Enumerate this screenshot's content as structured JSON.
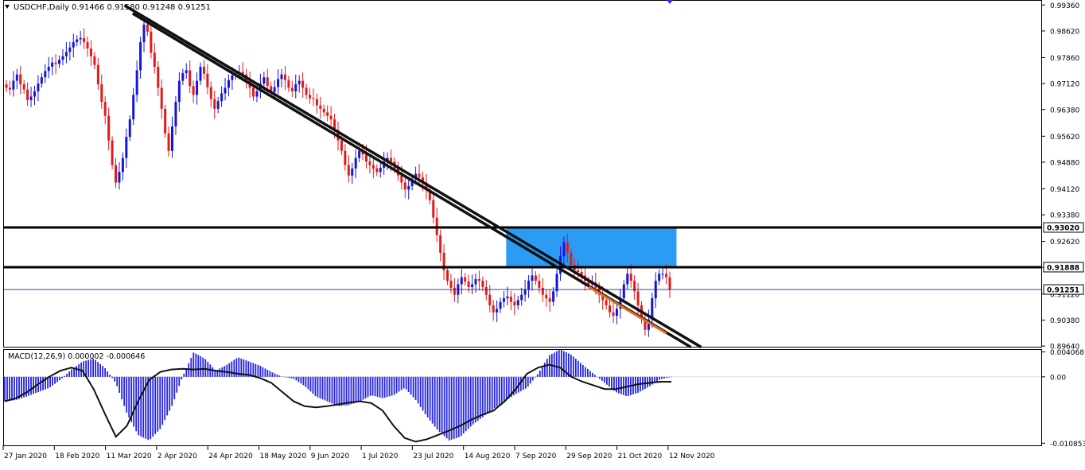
{
  "header": {
    "symbol_label": "USDCHF,Daily",
    "ohlc": "0.91466 0.91580 0.91248 0.91251"
  },
  "macd_header": "MACD(12,26,9) 0.000002 -0.000646",
  "colors": {
    "bull": "#1515d8",
    "bear": "#e01b1b",
    "zone": "#2196f3",
    "trend_line": "#111111",
    "level_line": "#000000",
    "current_line": "#2020a0",
    "orange_segment": "#e06b1e",
    "macd_hist": "#2323e0",
    "macd_signal": "#111111"
  },
  "chart_data": [
    {
      "type": "candlestick",
      "title": "USDCHF,Daily",
      "y_ticks": [
        "0.99360",
        "0.98620",
        "0.97860",
        "0.97120",
        "0.96380",
        "0.95620",
        "0.94880",
        "0.94120",
        "0.93380",
        "0.92620",
        "0.91880",
        "0.91120",
        "0.90380",
        "0.89640"
      ],
      "ylim": [
        0.8962,
        0.9948
      ],
      "x_ticks": [
        "27 Jan 2020",
        "18 Feb 2020",
        "11 Mar 2020",
        "2 Apr 2020",
        "24 Apr 2020",
        "18 May 2020",
        "9 Jun 2020",
        "1 Jul 2020",
        "23 Jul 2020",
        "14 Aug 2020",
        "7 Sep 2020",
        "29 Sep 2020",
        "21 Oct 2020",
        "12 Nov 2020"
      ],
      "levels": [
        {
          "label": "0.93020",
          "value": 0.9302
        },
        {
          "label": "0.91888",
          "value": 0.91888
        },
        {
          "label": "0.91251",
          "value": 0.91251
        }
      ],
      "zone": {
        "from": "18 Sep 2020",
        "to": "10 Dec 2020",
        "low": 0.91888,
        "high": 0.9302
      },
      "trend_lines": [
        {
          "from": [
            "20 Mar 2020",
            0.9912
          ],
          "to": [
            "17 Dec 2020",
            0.8961
          ]
        },
        {
          "from": [
            "16 Mar 2020",
            0.9935
          ],
          "to": [
            "22 Dec 2020",
            0.8961
          ]
        }
      ],
      "closes": [
        0.97,
        0.9695,
        0.972,
        0.9738,
        0.971,
        0.9695,
        0.9665,
        0.9675,
        0.969,
        0.9712,
        0.973,
        0.9748,
        0.976,
        0.9772,
        0.9768,
        0.978,
        0.979,
        0.9802,
        0.9815,
        0.983,
        0.9838,
        0.9842,
        0.983,
        0.9812,
        0.979,
        0.9765,
        0.971,
        0.966,
        0.962,
        0.955,
        0.948,
        0.943,
        0.946,
        0.95,
        0.956,
        0.961,
        0.968,
        0.975,
        0.983,
        0.988,
        0.986,
        0.98,
        0.976,
        0.97,
        0.964,
        0.957,
        0.952,
        0.959,
        0.966,
        0.972,
        0.9742,
        0.975,
        0.9705,
        0.968,
        0.972,
        0.976,
        0.974,
        0.9702,
        0.9668,
        0.964,
        0.9662,
        0.9684,
        0.97,
        0.9722,
        0.9735,
        0.974,
        0.9745,
        0.9738,
        0.9722,
        0.97,
        0.9675,
        0.969,
        0.9712,
        0.973,
        0.9705,
        0.9688,
        0.9702,
        0.9725,
        0.9738,
        0.9722,
        0.97,
        0.969,
        0.971,
        0.972,
        0.97,
        0.968,
        0.967,
        0.9668,
        0.965,
        0.964,
        0.963,
        0.962,
        0.961,
        0.958,
        0.955,
        0.952,
        0.948,
        0.945,
        0.947,
        0.95,
        0.952,
        0.951,
        0.949,
        0.948,
        0.947,
        0.946,
        0.9472,
        0.949,
        0.95,
        0.949,
        0.947,
        0.945,
        0.943,
        0.941,
        0.942,
        0.944,
        0.9455,
        0.9445,
        0.943,
        0.941,
        0.938,
        0.933,
        0.928,
        0.923,
        0.918,
        0.915,
        0.913,
        0.911,
        0.914,
        0.916,
        0.9148,
        0.9132,
        0.914,
        0.9155,
        0.915,
        0.9132,
        0.911,
        0.908,
        0.906,
        0.907,
        0.909,
        0.91,
        0.9105,
        0.909,
        0.908,
        0.9095,
        0.911,
        0.9125,
        0.915,
        0.9165,
        0.915,
        0.913,
        0.911,
        0.91,
        0.909,
        0.912,
        0.917,
        0.922,
        0.926,
        0.923,
        0.9195,
        0.918,
        0.9175,
        0.9165,
        0.915,
        0.914,
        0.9145,
        0.913,
        0.911,
        0.9095,
        0.908,
        0.906,
        0.905,
        0.907,
        0.91,
        0.914,
        0.917,
        0.915,
        0.912,
        0.908,
        0.904,
        0.901,
        0.904,
        0.91,
        0.915,
        0.917,
        0.917,
        0.916,
        0.9125
      ],
      "y_unit": "price",
      "series_note": "",
      "macd": {
        "label": "MACD(12,26,9) 0.000002 -0.000646",
        "y_ticks": [
          "0.004068",
          "0.00",
          "-0.010853"
        ],
        "ylim": [
          -0.0112,
          0.0044
        ],
        "histogram": [
          -0.004,
          -0.0038,
          -0.0032,
          -0.0025,
          -0.0018,
          -0.0005,
          0.0012,
          0.0025,
          0.003,
          0.0015,
          -0.001,
          -0.006,
          -0.0095,
          -0.0104,
          -0.0085,
          -0.005,
          0.0,
          0.004,
          0.003,
          0.001,
          0.002,
          0.0032,
          0.0025,
          0.0018,
          0.0008,
          0.0,
          -0.0003,
          -0.0015,
          -0.0032,
          -0.004,
          -0.0048,
          -0.0046,
          -0.004,
          -0.003,
          -0.0035,
          -0.003,
          -0.0018,
          -0.0038,
          -0.0065,
          -0.0088,
          -0.0104,
          -0.0098,
          -0.008,
          -0.0066,
          -0.0052,
          -0.004,
          -0.0028,
          -0.0018,
          0.0005,
          0.0035,
          0.0045,
          0.0036,
          0.002,
          0.0005,
          -0.001,
          -0.0025,
          -0.0032,
          -0.0026,
          -0.0016,
          -0.0004,
          0.0
        ],
        "signal": [
          -0.004,
          -0.0035,
          -0.0025,
          -0.0012,
          0.0,
          0.001,
          0.0015,
          0.001,
          -0.002,
          -0.006,
          -0.0098,
          -0.008,
          -0.004,
          -0.0005,
          0.0008,
          0.0012,
          0.0013,
          0.0012,
          0.0013,
          0.001,
          0.0008,
          0.0005,
          0.0003,
          -0.0002,
          -0.001,
          -0.0025,
          -0.004,
          -0.0048,
          -0.005,
          -0.0048,
          -0.0045,
          -0.0042,
          -0.004,
          -0.0043,
          -0.0055,
          -0.008,
          -0.01,
          -0.0106,
          -0.0102,
          -0.0095,
          -0.0088,
          -0.008,
          -0.007,
          -0.0062,
          -0.0055,
          -0.004,
          -0.002,
          0.0005,
          0.0015,
          0.002,
          0.0015,
          0.0,
          -0.0008,
          -0.0014,
          -0.002,
          -0.002,
          -0.0016,
          -0.0012,
          -0.001,
          -0.0008,
          -0.0008
        ]
      }
    }
  ]
}
